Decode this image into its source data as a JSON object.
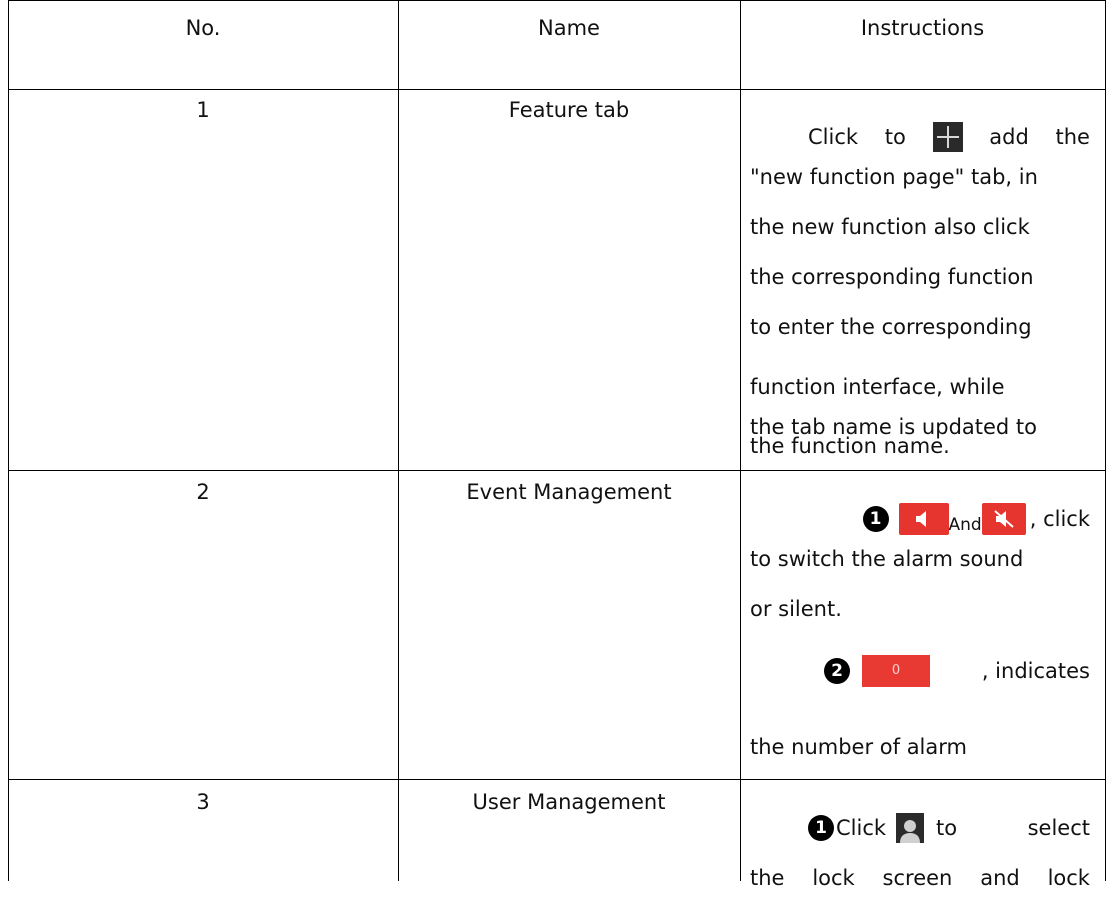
{
  "headers": {
    "no": "No.",
    "name": "Name",
    "instructions": "Instructions"
  },
  "rows": [
    {
      "no": "1",
      "name": "Feature tab",
      "instructions": {
        "lead_click": "Click",
        "lead_to": "to",
        "lead_add": "add",
        "lead_the": "the",
        "plus_icon": "plus-icon",
        "lines": [
          "\"new function page\" tab, in",
          "the new function also click",
          "the corresponding function",
          "to enter the corresponding",
          "function interface, while",
          "the tab name is updated to",
          "the function name."
        ]
      }
    },
    {
      "no": "2",
      "name": "Event Management",
      "instructions": {
        "step1_num": "1",
        "speaker_icon": "speaker-on-icon",
        "and": "And",
        "mute_icon": "speaker-muted-icon",
        "click": ", click",
        "lines1": [
          "to switch the alarm sound",
          "or silent."
        ],
        "step2_num": "2",
        "badge_value": "0",
        "indicates": ", indicates",
        "line2": "the number of alarm"
      }
    },
    {
      "no": "3",
      "name": "User Management",
      "instructions": {
        "step1_num": "1",
        "click": "Click",
        "user_icon": "user-icon",
        "to": "to",
        "select": "select",
        "line_a_words": [
          "the",
          "lock",
          "screen",
          "and",
          "lock"
        ]
      }
    }
  ],
  "colors": {
    "alarm_red": "#e5352e",
    "icon_dark": "#2a2a2a"
  }
}
